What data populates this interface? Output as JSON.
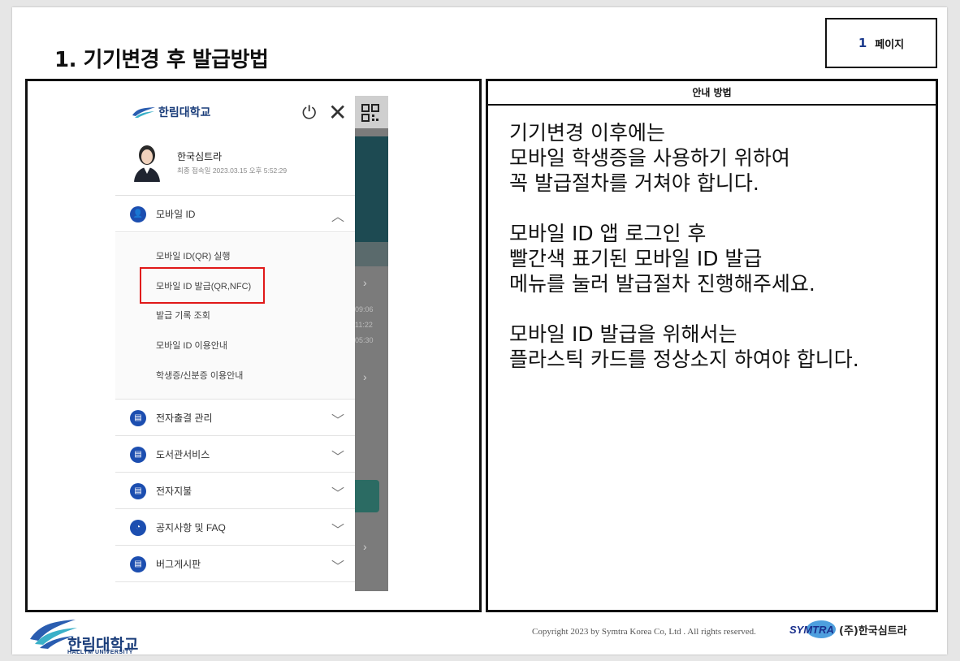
{
  "slide": {
    "title": "1. 기기변경 후 발급방법",
    "page_number": "1",
    "page_label": "페이지"
  },
  "phone": {
    "logo_text": "한림대학교",
    "profile_name": "한국심트라",
    "profile_last_login": "최종 접속일 2023.03.15 오후 5:52:29",
    "menu_mobile_id": "모바일 ID",
    "submenu": [
      "모바일 ID(QR) 실행",
      "모바일 ID 발급(QR,NFC)",
      "발급 기록 조회",
      "모바일 ID 이용안내",
      "학생증/신분증 이용안내"
    ],
    "menus": [
      "전자출결 관리",
      "도서관서비스",
      "전자지불",
      "공지사항 및 FAQ",
      "버그게시판"
    ],
    "bg_partial_times": [
      "09:06",
      "11:22",
      "05:30"
    ]
  },
  "guide": {
    "header": "안내 방법",
    "para1": [
      "기기변경 이후에는",
      "모바일 학생증을 사용하기 위하여",
      "꼭 발급절차를 거쳐야 합니다."
    ],
    "para2": [
      "모바일 ID 앱 로그인 후",
      "빨간색 표기된 모바일 ID 발급",
      "메뉴를 눌러 발급절차 진행해주세요."
    ],
    "para3": [
      "모바일 ID 발급을 위해서는",
      "플라스틱 카드를 정상소지 하여야 합니다."
    ]
  },
  "footer": {
    "university_kr": "한림대학교",
    "university_en": "HALLYM UNIVERSITY",
    "copyright": "Copyright  2023 by Symtra Korea Co, Ltd . All rights reserved.",
    "symtra_logo": "SYMTRA",
    "company": "(주)한국심트라"
  },
  "colors": {
    "highlight": "#e01818",
    "brand_blue": "#1c4eb0"
  }
}
